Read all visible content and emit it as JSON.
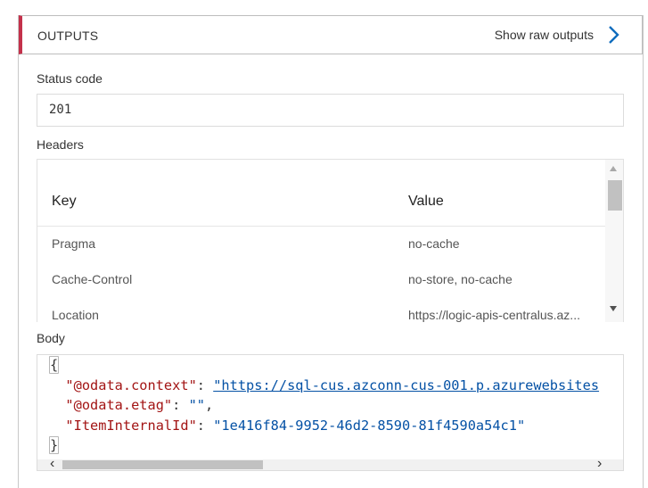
{
  "outputs": {
    "title": "OUTPUTS",
    "raw_link": "Show raw outputs",
    "accent_color": "#c4314b",
    "link_icon": "chevron-right-icon"
  },
  "status": {
    "label": "Status code",
    "value": "201"
  },
  "headers": {
    "label": "Headers",
    "columns": [
      "Key",
      "Value"
    ],
    "rows": [
      {
        "key": "Pragma",
        "value": "no-cache"
      },
      {
        "key": "Cache-Control",
        "value": "no-store, no-cache"
      },
      {
        "key": "Location",
        "value": "https://logic-apis-centralus.az..."
      }
    ]
  },
  "body": {
    "label": "Body",
    "open_brace": "{",
    "close_brace": "}",
    "lines": [
      {
        "key": "\"@odata.context\"",
        "sep": ": ",
        "value": "\"https://sql-cus.azconn-cus-001.p.azurewebsites",
        "end": ""
      },
      {
        "key": "\"@odata.etag\"",
        "sep": ": ",
        "value": "\"\"",
        "end": ","
      },
      {
        "key": "\"ItemInternalId\"",
        "sep": ": ",
        "value": "\"1e416f84-9952-46d2-8590-81f4590a54c1\"",
        "end": ""
      }
    ]
  }
}
